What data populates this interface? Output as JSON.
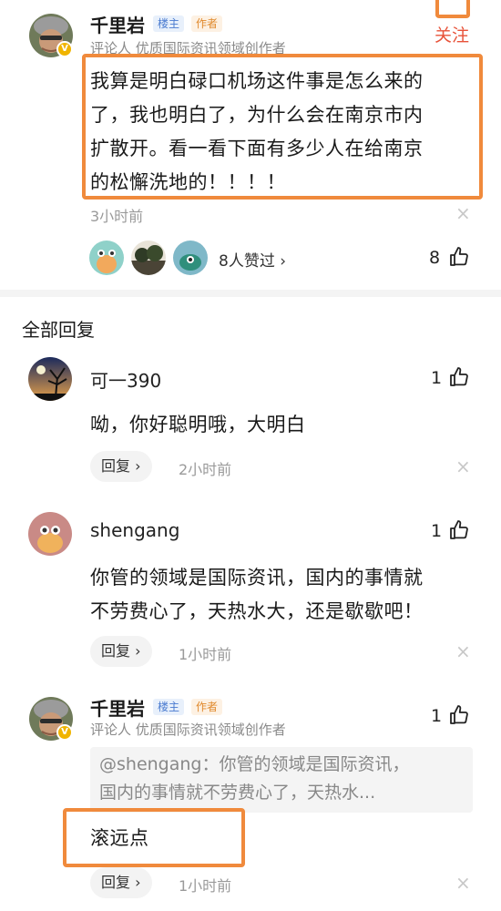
{
  "top_comment": {
    "author": "千里岩",
    "tag_owner": "楼主",
    "tag_author": "作者",
    "follow_label": "关注",
    "subtitle": "评论人 优质国际资讯领域创作者",
    "badge": "V",
    "text_lines": [
      "我算是明白碌口机场这件事是怎么来的",
      "了，我也明白了，为什么会在南京市内",
      "扩散开。看一看下面有多少人在给南京",
      "的松懈洗地的！！！！"
    ],
    "time": "3小时前",
    "likers_text": "8人赞过 ›",
    "like_count": "8"
  },
  "section_title": "全部回复",
  "replies": [
    {
      "author": "可一390",
      "like_count": "1",
      "text_lines": [
        "呦，你好聪明哦，大明白"
      ],
      "reply_label": "回复 ›",
      "time": "2小时前"
    },
    {
      "author": "shengang",
      "like_count": "1",
      "text_lines": [
        "你管的领域是国际资讯，国内的事情就",
        "不劳费心了，天热水大，还是歇歇吧！"
      ],
      "reply_label": "回复 ›",
      "time": "1小时前"
    },
    {
      "author": "千里岩",
      "tag_owner": "楼主",
      "tag_author": "作者",
      "subtitle": "评论人 优质国际资讯领域创作者",
      "badge": "V",
      "like_count": "1",
      "quote_lines": [
        "@shengang：你管的领域是国际资讯，",
        "国内的事情就不劳费心了，天热水..."
      ],
      "text_lines": [
        "滚远点"
      ],
      "reply_label": "回复 ›",
      "time": "1小时前"
    }
  ],
  "close_icon": "×",
  "colors": {
    "highlight_orange": "#f08a3c",
    "follow_red": "#e8533a",
    "tag_blue": "#4a7bd0",
    "tag_orange": "#e0892c",
    "vip_gold": "#f0b400"
  }
}
